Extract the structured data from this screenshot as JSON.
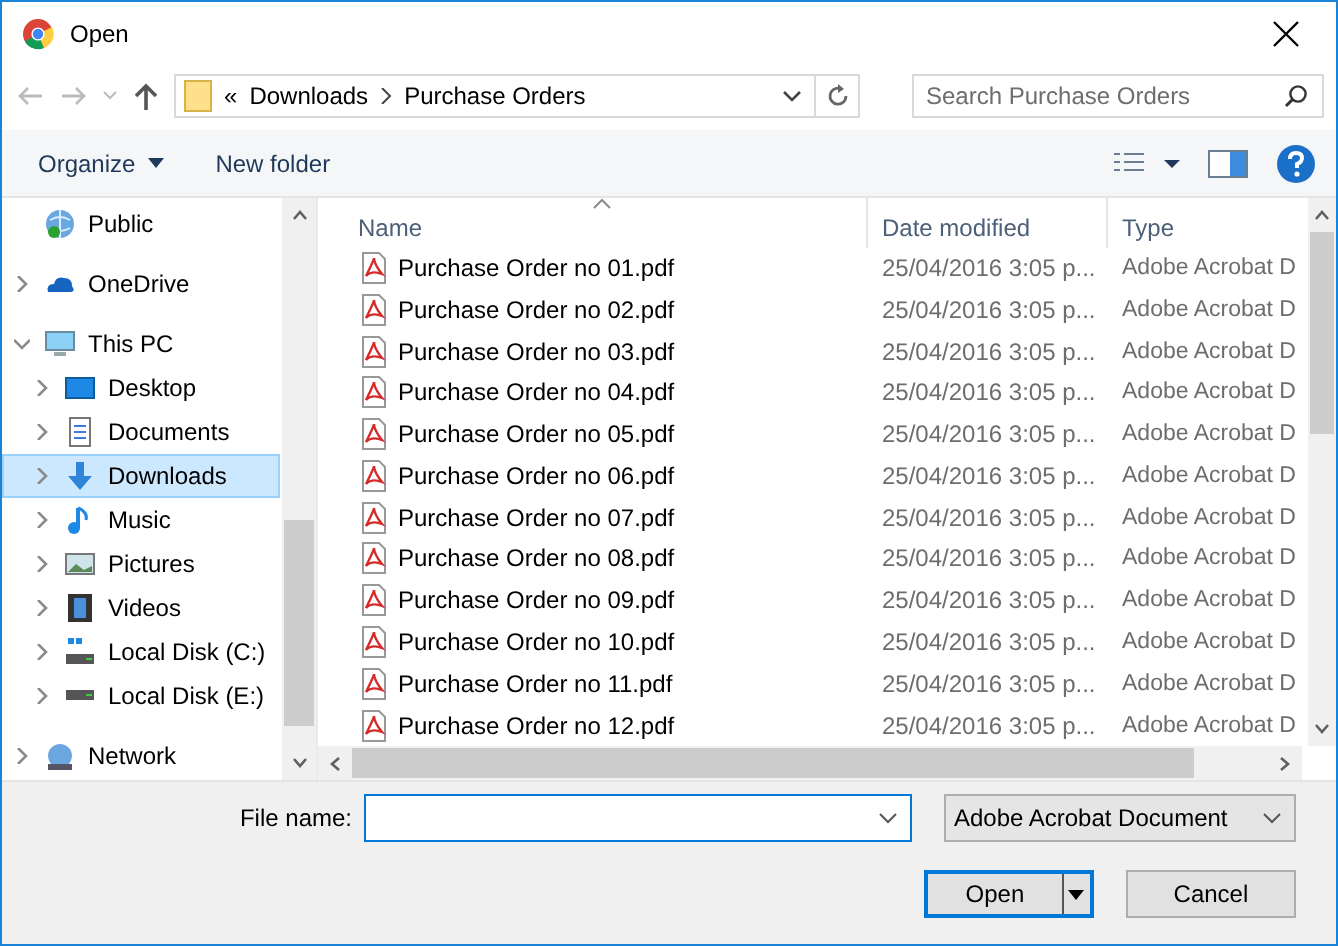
{
  "window": {
    "title": "Open"
  },
  "address": {
    "overflow": "«",
    "breadcrumb": [
      "Downloads",
      "Purchase Orders"
    ]
  },
  "search": {
    "placeholder": "Search Purchase Orders"
  },
  "toolbar": {
    "organize": "Organize",
    "new_folder": "New folder"
  },
  "sidebar": {
    "items": [
      {
        "label": "Public",
        "kind": "network-folder",
        "selected": false
      },
      {
        "label": "OneDrive",
        "kind": "cloud",
        "expanded": false,
        "selected": false
      },
      {
        "label": "This PC",
        "kind": "computer",
        "expanded": true,
        "selected": false,
        "children": [
          {
            "label": "Desktop",
            "kind": "desktop",
            "expanded": false,
            "selected": false
          },
          {
            "label": "Documents",
            "kind": "documents",
            "expanded": false,
            "selected": false
          },
          {
            "label": "Downloads",
            "kind": "downloads",
            "expanded": false,
            "selected": true
          },
          {
            "label": "Music",
            "kind": "music",
            "expanded": false,
            "selected": false
          },
          {
            "label": "Pictures",
            "kind": "pictures",
            "expanded": false,
            "selected": false
          },
          {
            "label": "Videos",
            "kind": "videos",
            "expanded": false,
            "selected": false
          },
          {
            "label": "Local Disk (C:)",
            "kind": "system-drive",
            "expanded": false,
            "selected": false
          },
          {
            "label": "Local Disk (E:)",
            "kind": "drive",
            "expanded": false,
            "selected": false
          }
        ]
      },
      {
        "label": "Network",
        "kind": "network",
        "expanded": false,
        "selected": false
      }
    ]
  },
  "file_list": {
    "columns": [
      "Name",
      "Date modified",
      "Type"
    ],
    "rows": [
      {
        "name": "Purchase Order no 01.pdf",
        "date": "25/04/2016 3:05 p...",
        "type": "Adobe Acrobat D"
      },
      {
        "name": "Purchase Order no 02.pdf",
        "date": "25/04/2016 3:05 p...",
        "type": "Adobe Acrobat D"
      },
      {
        "name": "Purchase Order no 03.pdf",
        "date": "25/04/2016 3:05 p...",
        "type": "Adobe Acrobat D"
      },
      {
        "name": "Purchase Order no 04.pdf",
        "date": "25/04/2016 3:05 p...",
        "type": "Adobe Acrobat D"
      },
      {
        "name": "Purchase Order no 05.pdf",
        "date": "25/04/2016 3:05 p...",
        "type": "Adobe Acrobat D"
      },
      {
        "name": "Purchase Order no 06.pdf",
        "date": "25/04/2016 3:05 p...",
        "type": "Adobe Acrobat D"
      },
      {
        "name": "Purchase Order no 07.pdf",
        "date": "25/04/2016 3:05 p...",
        "type": "Adobe Acrobat D"
      },
      {
        "name": "Purchase Order no 08.pdf",
        "date": "25/04/2016 3:05 p...",
        "type": "Adobe Acrobat D"
      },
      {
        "name": "Purchase Order no 09.pdf",
        "date": "25/04/2016 3:05 p...",
        "type": "Adobe Acrobat D"
      },
      {
        "name": "Purchase Order no 10.pdf",
        "date": "25/04/2016 3:05 p...",
        "type": "Adobe Acrobat D"
      },
      {
        "name": "Purchase Order no 11.pdf",
        "date": "25/04/2016 3:05 p...",
        "type": "Adobe Acrobat D"
      },
      {
        "name": "Purchase Order no 12.pdf",
        "date": "25/04/2016 3:05 p...",
        "type": "Adobe Acrobat D"
      }
    ]
  },
  "footer": {
    "file_name_label": "File name:",
    "file_type": "Adobe Acrobat Document",
    "buttons": [
      "Open",
      "Cancel"
    ]
  }
}
